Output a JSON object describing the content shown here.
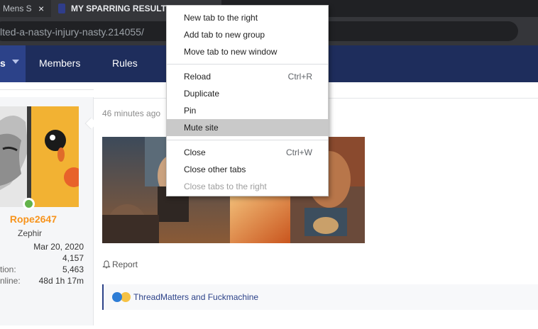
{
  "browser": {
    "tabs": [
      {
        "title": "Mens S",
        "close": "×"
      },
      {
        "title": "MY SPARRING RESULTED A NASTY INJURY NASTY"
      }
    ],
    "url": "lted-a-nasty-injury-nasty.214055/"
  },
  "nav": {
    "active_fragment": "s",
    "items": [
      "Members",
      "Rules"
    ]
  },
  "context_menu": {
    "groups": [
      [
        {
          "label": "New tab to the right",
          "shortcut": ""
        },
        {
          "label": "Add tab to new group",
          "shortcut": ""
        },
        {
          "label": "Move tab to new window",
          "shortcut": ""
        }
      ],
      [
        {
          "label": "Reload",
          "shortcut": "Ctrl+R"
        },
        {
          "label": "Duplicate",
          "shortcut": ""
        },
        {
          "label": "Pin",
          "shortcut": ""
        },
        {
          "label": "Mute site",
          "shortcut": "",
          "highlighted": true
        }
      ],
      [
        {
          "label": "Close",
          "shortcut": "Ctrl+W"
        },
        {
          "label": "Close other tabs",
          "shortcut": ""
        },
        {
          "label": "Close tabs to the right",
          "shortcut": "",
          "disabled": true
        }
      ]
    ]
  },
  "user": {
    "name": "Rope2647",
    "title": "Zephir",
    "stats": [
      {
        "label": "",
        "value": "Mar 20, 2020"
      },
      {
        "label": "",
        "value": "4,157"
      },
      {
        "label": "tion:",
        "value": "5,463"
      },
      {
        "label": "nline:",
        "value": "48d 1h 17m"
      }
    ]
  },
  "post": {
    "time": "46 minutes ago",
    "report": "Report",
    "reactions": "ThreadMatters and Fuckmachine"
  },
  "colors": {
    "nav_bg": "#1e2d5c",
    "nav_active": "#2c4289",
    "username": "#f7941d",
    "menu_highlight": "#c9c9c9"
  }
}
